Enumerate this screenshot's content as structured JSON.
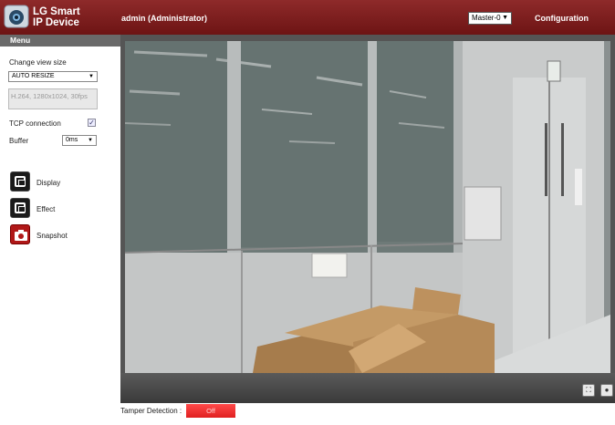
{
  "app": {
    "brand_line1": "LG Smart",
    "brand_line2": "IP Device",
    "user": "admin (Administrator)",
    "stream_select": "Master-0",
    "config_label": "Configuration"
  },
  "colors": {
    "header": "#7a1c1c",
    "tamper_off": "#f03030",
    "menu_bar": "#6a6a6a"
  },
  "sidebar": {
    "menu_title": "Menu",
    "view_size_label": "Change view size",
    "view_size_value": "AUTO RESIZE",
    "codec_info": "H.264, 1280x1024, 30fps",
    "tcp_label": "TCP connection",
    "tcp_checked": true,
    "buffer_label": "Buffer",
    "buffer_value": "0ms",
    "tools": [
      {
        "label": "Display",
        "icon": "display-icon"
      },
      {
        "label": "Effect",
        "icon": "effect-icon"
      },
      {
        "label": "Snapshot",
        "icon": "camera-icon"
      }
    ]
  },
  "video": {
    "controls": [
      {
        "icon": "fullscreen-icon",
        "glyph": "⛶"
      },
      {
        "icon": "record-icon",
        "glyph": "●"
      }
    ]
  },
  "footer": {
    "tamper_label": "Tamper Detection :",
    "tamper_value": "Off"
  }
}
